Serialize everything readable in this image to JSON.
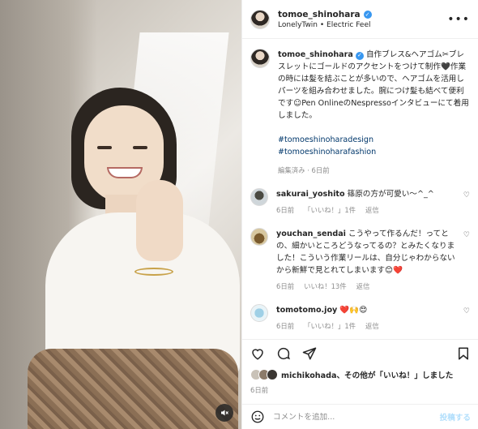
{
  "header": {
    "username": "tomoe_shinohara",
    "subtitle": "LonelyTwin • Electric Feel",
    "more_label": "•••"
  },
  "caption": {
    "username": "tomoe_shinohara",
    "text": "自作ブレス&ヘアゴム✂︎ブレスレットにゴールドのアクセントをつけて制作🖤作業の時には髪を結ぶことが多いので、ヘアゴムを活用しパーツを組み合わせました。腕につけ髪も結べて便利です☺︎Pen OnlineのNespressoインタビューにて着用しました。",
    "hashtags": [
      "#tomoeshinoharadesign",
      "#tomoeshinoharafashion"
    ],
    "meta": "編集済み · 6日前"
  },
  "comments": [
    {
      "username": "sakurai_yoshito",
      "text": "篠原の方が可愛い〜^_^",
      "time": "6日前",
      "likes": "「いいね！」1件",
      "reply": "返信"
    },
    {
      "username": "youchan_sendai",
      "text": "こうやって作るんだ！ってとの、細かいところどうなってるの？とみたくなりました！こういう作業リールは、自分じゃわからないから新鮮で見とれてしまいます😊❤️",
      "time": "6日前",
      "likes": "いいね！13件",
      "reply": "返信"
    },
    {
      "username": "tomotomo.joy",
      "text": "❤️🙌😍",
      "time": "6日前",
      "likes": "「いいね！」1件",
      "reply": "返信"
    }
  ],
  "likes": {
    "user": "michikohada",
    "text": "、その他が「いいね！」しました"
  },
  "post_time": "6日前",
  "add_comment": {
    "placeholder": "コメントを追加...",
    "post_label": "投稿する"
  },
  "icons": {
    "like": "heart-icon",
    "comment": "comment-icon",
    "share": "share-icon",
    "save": "bookmark-icon",
    "emoji": "emoji-icon",
    "mute": "mute-icon"
  }
}
